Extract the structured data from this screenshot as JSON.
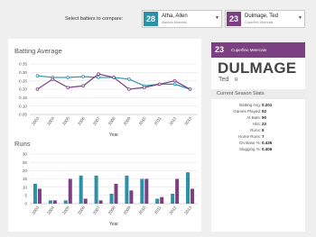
{
  "compare": {
    "label": "Select batters to compare:",
    "batter1": {
      "number": "28",
      "name": "Atha, Allen",
      "team": "Alaskan Mammal",
      "color": "#2b91a8"
    },
    "batter2": {
      "number": "23",
      "name": "Dulmage, Ted",
      "team": "Cuperfino Meercats",
      "color": "#7b3f82"
    }
  },
  "player": {
    "number": "23",
    "team": "Cuperfino Meercats",
    "last_name": "DULMAGE",
    "first_name": "Ted",
    "bats_icon": "R",
    "section_title": "Current Season Stats",
    "stats": [
      {
        "label": "Batting Avg:",
        "value": "0.201"
      },
      {
        "label": "Games Played:",
        "value": "92"
      },
      {
        "label": "At Bats:",
        "value": "90"
      },
      {
        "label": "Hits:",
        "value": "23"
      },
      {
        "label": "Runs:",
        "value": "9"
      },
      {
        "label": "Home Runs:",
        "value": "7"
      },
      {
        "label": "On Base %:",
        "value": "0.435"
      },
      {
        "label": "Slugging %:",
        "value": "0.406"
      }
    ]
  },
  "chart_data": [
    {
      "type": "line",
      "title": "Batting Average",
      "xlabel": "Year",
      "categories": [
        "2003",
        "2004",
        "2005",
        "2006",
        "2007",
        "2008",
        "2009",
        "2010",
        "2011",
        "2012",
        "2013"
      ],
      "yticks": [
        "0.05",
        "0.10",
        "0.15",
        "0.20",
        "0.25",
        "0.30",
        "0.35"
      ],
      "ylim": [
        0.05,
        0.35
      ],
      "series": [
        {
          "color": "#2b91a8",
          "values": [
            0.28,
            0.27,
            0.27,
            0.275,
            0.27,
            0.27,
            0.26,
            0.22,
            0.23,
            0.23,
            0.2
          ]
        },
        {
          "color": "#7b3f82",
          "values": [
            0.2,
            0.26,
            0.21,
            0.22,
            0.29,
            0.27,
            0.2,
            0.21,
            0.23,
            0.25,
            0.2
          ]
        }
      ]
    },
    {
      "type": "bar",
      "title": "Runs",
      "xlabel": "Year",
      "categories": [
        "2003",
        "2004",
        "2005",
        "2006",
        "2007",
        "2008",
        "2009",
        "2010",
        "2011",
        "2012",
        "2013"
      ],
      "yticks": [
        "0",
        "5",
        "10",
        "15",
        "20",
        "25",
        "30"
      ],
      "ylim": [
        0,
        30
      ],
      "series": [
        {
          "color": "#2b91a8",
          "values": [
            12,
            2,
            2,
            17,
            17,
            6,
            17,
            15,
            3,
            6,
            19
          ]
        },
        {
          "color": "#7b3f82",
          "values": [
            9,
            2,
            15,
            3,
            2,
            12,
            8,
            15,
            4,
            15,
            9
          ]
        }
      ]
    }
  ]
}
